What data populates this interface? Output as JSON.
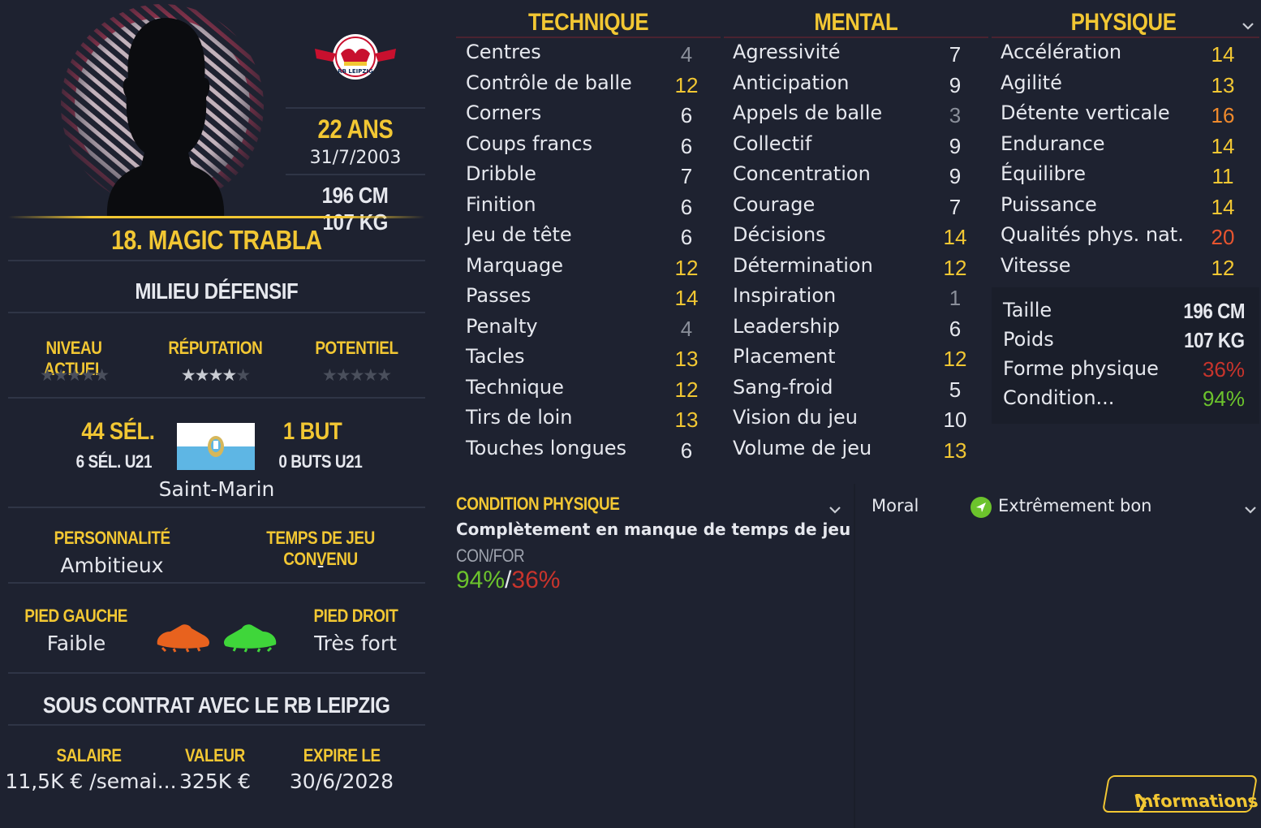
{
  "player": {
    "age": "22 ANS",
    "dob": "31/7/2003",
    "height": "196 CM",
    "weight": "107 KG",
    "name": "18. MAGIC TRABLA",
    "position": "MILIEU DÉFENSIF",
    "nation": "Saint-Marin"
  },
  "club": {
    "logo_icon": "rb-leipzig-crest-icon"
  },
  "ratings": {
    "current": {
      "label": "NIVEAU ACTUEL",
      "stars": 0,
      "max": 5
    },
    "reputation": {
      "label": "RÉPUTATION",
      "stars": 4,
      "max": 5
    },
    "potential": {
      "label": "POTENTIEL",
      "stars": 0,
      "max": 5
    }
  },
  "international": {
    "caps": "44 SÉL.",
    "caps_u21": "6 SÉL. U21",
    "goals": "1 BUT",
    "goals_u21": "0 BUTS U21"
  },
  "personality": {
    "label": "PERSONNALITÉ",
    "value": "Ambitieux"
  },
  "playing_time": {
    "label": "TEMPS DE JEU CONVENU",
    "value": "-"
  },
  "feet": {
    "left_label": "PIED GAUCHE",
    "left_value": "Faible",
    "right_label": "PIED DROIT",
    "right_value": "Très fort"
  },
  "contract": {
    "title": "SOUS CONTRAT AVEC LE RB LEIPZIG",
    "salary_label": "SALAIRE",
    "salary": "11,5K € /semai...",
    "value_label": "VALEUR",
    "value": "325K €",
    "expiry_label": "EXPIRE LE",
    "expiry": "30/6/2028"
  },
  "attributes": {
    "technique_title": "TECHNIQUE",
    "mental_title": "MENTAL",
    "physique_title": "PHYSIQUE",
    "technique": [
      {
        "name": "Centres",
        "value": "4"
      },
      {
        "name": "Contrôle de balle",
        "value": "12"
      },
      {
        "name": "Corners",
        "value": "6"
      },
      {
        "name": "Coups francs",
        "value": "6"
      },
      {
        "name": "Dribble",
        "value": "7"
      },
      {
        "name": "Finition",
        "value": "6"
      },
      {
        "name": "Jeu de tête",
        "value": "6"
      },
      {
        "name": "Marquage",
        "value": "12"
      },
      {
        "name": "Passes",
        "value": "14"
      },
      {
        "name": "Penalty",
        "value": "4"
      },
      {
        "name": "Tacles",
        "value": "13"
      },
      {
        "name": "Technique",
        "value": "12"
      },
      {
        "name": "Tirs de loin",
        "value": "13"
      },
      {
        "name": "Touches longues",
        "value": "6"
      }
    ],
    "mental": [
      {
        "name": "Agressivité",
        "value": "7"
      },
      {
        "name": "Anticipation",
        "value": "9"
      },
      {
        "name": "Appels de balle",
        "value": "3"
      },
      {
        "name": "Collectif",
        "value": "9"
      },
      {
        "name": "Concentration",
        "value": "9"
      },
      {
        "name": "Courage",
        "value": "7"
      },
      {
        "name": "Décisions",
        "value": "14"
      },
      {
        "name": "Détermination",
        "value": "12"
      },
      {
        "name": "Inspiration",
        "value": "1"
      },
      {
        "name": "Leadership",
        "value": "6"
      },
      {
        "name": "Placement",
        "value": "12"
      },
      {
        "name": "Sang-froid",
        "value": "5"
      },
      {
        "name": "Vision du jeu",
        "value": "10"
      },
      {
        "name": "Volume de jeu",
        "value": "13"
      }
    ],
    "physique": [
      {
        "name": "Accélération",
        "value": "14"
      },
      {
        "name": "Agilité",
        "value": "13"
      },
      {
        "name": "Détente verticale",
        "value": "16"
      },
      {
        "name": "Endurance",
        "value": "14"
      },
      {
        "name": "Équilibre",
        "value": "11"
      },
      {
        "name": "Puissance",
        "value": "14"
      },
      {
        "name": "Qualités phys. nat.",
        "value": "20"
      },
      {
        "name": "Vitesse",
        "value": "12"
      }
    ]
  },
  "physical_info": {
    "height_label": "Taille",
    "height": "196 CM",
    "weight_label": "Poids",
    "weight": "107 KG",
    "fitness_label": "Forme physique",
    "fitness": "36%",
    "condition_label": "Condition...",
    "condition": "94%"
  },
  "condition_panel": {
    "title": "CONDITION PHYSIQUE",
    "description": "Complètement en manque de temps de jeu",
    "con_for_label": "CON/FOR",
    "con": "94%",
    "slash": "/",
    "for": "36%"
  },
  "morale": {
    "label": "Moral",
    "value": "Extrêmement bon"
  },
  "info_button": {
    "label": "Informations"
  },
  "colors": {
    "accent": "#f2c733",
    "background": "#1e2230",
    "good": "#6cc32c",
    "bad": "#c8342c",
    "orange": "#f08a2c"
  }
}
